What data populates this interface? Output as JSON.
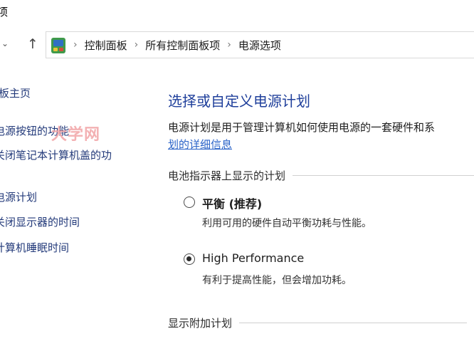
{
  "window": {
    "title_fragment": "项"
  },
  "navigation": {
    "breadcrumbs": [
      "控制面板",
      "所有控制面板项",
      "电源选项"
    ]
  },
  "left_pane": {
    "links": [
      "板主页",
      "电源按钮的功能",
      "关闭笔记本计算机盖的功",
      "电源计划",
      "关闭显示器的时间",
      "计算机睡眠时间"
    ]
  },
  "watermark": "大学网",
  "main": {
    "title": "选择或自定义电源计划",
    "description": "电源计划是用于管理计算机如何使用电源的一套硬件和系",
    "details_link": "划的详细信息",
    "battery_section_label": "电池指示器上显示的计划",
    "plans": [
      {
        "name": "平衡 (推荐)",
        "description": "利用可用的硬件自动平衡功耗与性能。",
        "selected": false
      },
      {
        "name": "High Performance",
        "description": "有利于提高性能，但会增加功耗。",
        "selected": true
      }
    ],
    "extra_plans_label": "显示附加计划"
  },
  "colors": {
    "title_blue": "#1f3f9b",
    "link_blue": "#2a63c8",
    "left_link": "#233a7a",
    "watermark": "#f2a4a6"
  },
  "icons": {
    "control_panel": "control-panel-icon",
    "up": "up-arrow-icon",
    "down": "chevron-down-icon",
    "separator": "chevron-right-icon"
  }
}
